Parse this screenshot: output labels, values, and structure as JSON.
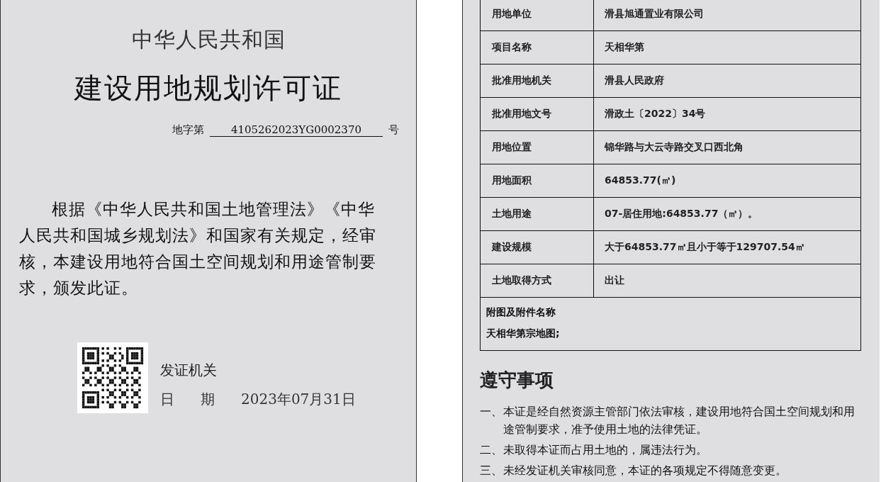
{
  "certificate": {
    "country": "中华人民共和国",
    "title": "建设用地规划许可证",
    "number_label": "地字第",
    "number": "4105262023YG0002370",
    "number_suffix": "号",
    "paragraph": "根据《中华人民共和国土地管理法》《中华人民共和国城乡规划法》和国家有关规定，经审核，本建设用地符合国土空间规划和用途管制要求，颁发此证。",
    "issuer_label": "发证机关",
    "date_label": [
      "日",
      "期"
    ],
    "date": "2023年07月31日"
  },
  "details": {
    "rows": [
      {
        "label": "用地单位",
        "value": "滑县旭通置业有限公司"
      },
      {
        "label": "项目名称",
        "value": "天相华第"
      },
      {
        "label": "批准用地机关",
        "value": "滑县人民政府"
      },
      {
        "label": "批准用地文号",
        "value": "滑政土〔2022〕34号"
      },
      {
        "label": "用地位置",
        "value": "锦华路与大云寺路交叉口西北角"
      },
      {
        "label": "用地面积",
        "value": "64853.77(㎡)"
      },
      {
        "label": "土地用途",
        "value": "07-居住用地:64853.77（㎡）。"
      },
      {
        "label": "建设规模",
        "value": "大于64853.77㎡且小于等于129707.54㎡"
      },
      {
        "label": "土地取得方式",
        "value": "出让"
      }
    ],
    "attachments": {
      "label": "附图及附件名称",
      "value": "天相华第宗地图;"
    }
  },
  "notices": {
    "title": "遵守事项",
    "items": [
      {
        "marker": "一、",
        "text": "本证是经自然资源主管部门依法审核，建设用地符合国土空间规划和用途管制要求，准予使用土地的法律凭证。"
      },
      {
        "marker": "二、",
        "text": "未取得本证而占用土地的，属违法行为。"
      },
      {
        "marker": "三、",
        "text": "未经发证机关审核同意，本证的各项规定不得随意变更。"
      }
    ]
  }
}
